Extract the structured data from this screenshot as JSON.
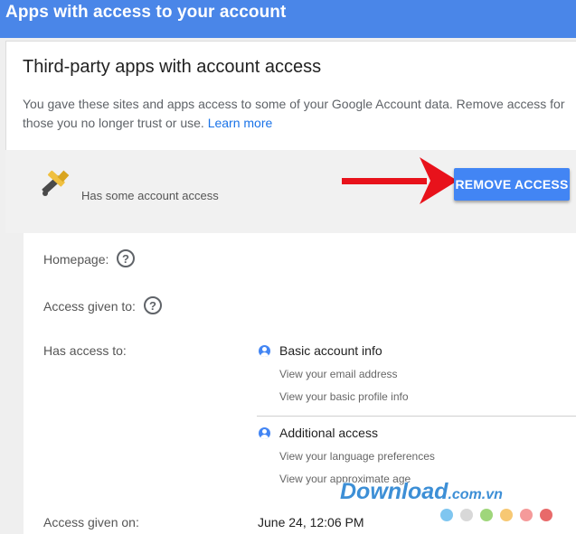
{
  "header": {
    "title": "Apps with access to your account"
  },
  "card": {
    "title": "Third-party apps with account access",
    "description": "You gave these sites and apps access to some of your Google Account data. Remove access for those you no longer trust or use.",
    "learn_more": "Learn more"
  },
  "app": {
    "icon": "tools-icon",
    "status": "Has some account access",
    "remove_button": "REMOVE ACCESS"
  },
  "details": {
    "homepage_label": "Homepage:",
    "access_given_to_label": "Access given to:",
    "has_access_to_label": "Has access to:",
    "help_glyph": "?",
    "scopes": [
      {
        "title": "Basic account info",
        "items": [
          "View your email address",
          "View your basic profile info"
        ]
      },
      {
        "title": "Additional access",
        "items": [
          "View your language preferences",
          "View your approximate age"
        ]
      }
    ],
    "access_given_on_label": "Access given on:",
    "access_given_on_value": "June 24, 12:06 PM"
  },
  "watermark": {
    "text": "Download",
    "suffix": ".com.vn",
    "dot_colors": [
      "#7fc6f0",
      "#d8d8d8",
      "#9fd67b",
      "#f7c873",
      "#f59a9a",
      "#e86a6a"
    ]
  },
  "colors": {
    "brand": "#4a86e8",
    "button": "#4285f4",
    "arrow": "#e8121b"
  }
}
